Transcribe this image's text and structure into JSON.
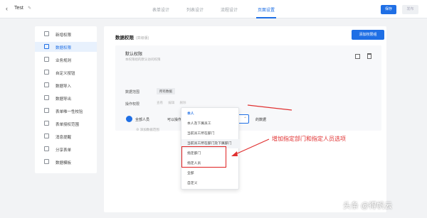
{
  "topbar": {
    "back_glyph": "‹",
    "app_title": "Test",
    "edit_glyph": "✎",
    "tabs": [
      {
        "label": "表单设计"
      },
      {
        "label": "列表设计"
      },
      {
        "label": "流程设计"
      },
      {
        "label": "页面设置"
      }
    ],
    "active_tab": "页面设置",
    "save_label": "保存",
    "publish_label": "发布"
  },
  "sidebar": {
    "items": [
      {
        "label": "新增权限",
        "icon": "doc-icon"
      },
      {
        "label": "数据权限",
        "icon": "doc-icon",
        "active": true
      },
      {
        "label": "业务规则",
        "icon": "rule-icon"
      },
      {
        "label": "自定义按钮",
        "icon": "button-icon"
      },
      {
        "label": "数据导入",
        "icon": "import-icon"
      },
      {
        "label": "数据导出",
        "icon": "export-icon"
      },
      {
        "label": "表单唯一性校验",
        "icon": "check-icon"
      },
      {
        "label": "表单授权范围",
        "icon": "scope-icon"
      },
      {
        "label": "消息提醒",
        "icon": "bell-icon"
      },
      {
        "label": "分享表单",
        "icon": "share-icon"
      },
      {
        "label": "数据模板",
        "icon": "template-icon"
      }
    ]
  },
  "main": {
    "title": "数据权限",
    "title_hint": "(高级版)",
    "add_button": "添加权限组",
    "card": {
      "title": "默认权限",
      "subtitle": "本权限组的默认访问权限",
      "range_label": "数据范围",
      "range_chip": "所有数据",
      "ops_label": "操作权限",
      "ops": [
        "查看",
        "编辑",
        "删除"
      ],
      "person_label": "全部人员",
      "can_op_label": "可以操作",
      "select_value": "本人",
      "of_data_label": "的数据",
      "add_range": "添加数据范围"
    }
  },
  "dropdown": {
    "options": [
      {
        "label": "本人",
        "selected": true
      },
      {
        "label": "本人及下属员工"
      },
      {
        "label": "当前员工所在部门"
      },
      {
        "label": "当前员工所在部门及下属部门",
        "hover": true
      },
      {
        "label": "指定部门"
      },
      {
        "label": "指定人员"
      },
      {
        "label": "全部"
      },
      {
        "label": "自定义"
      }
    ]
  },
  "annotation": {
    "text": "增加指定部门和指定人员选项",
    "color": "#e03030"
  },
  "watermark": "头条 @得帆云",
  "colors": {
    "accent": "#1f6fe5",
    "annotation": "#e03030"
  }
}
